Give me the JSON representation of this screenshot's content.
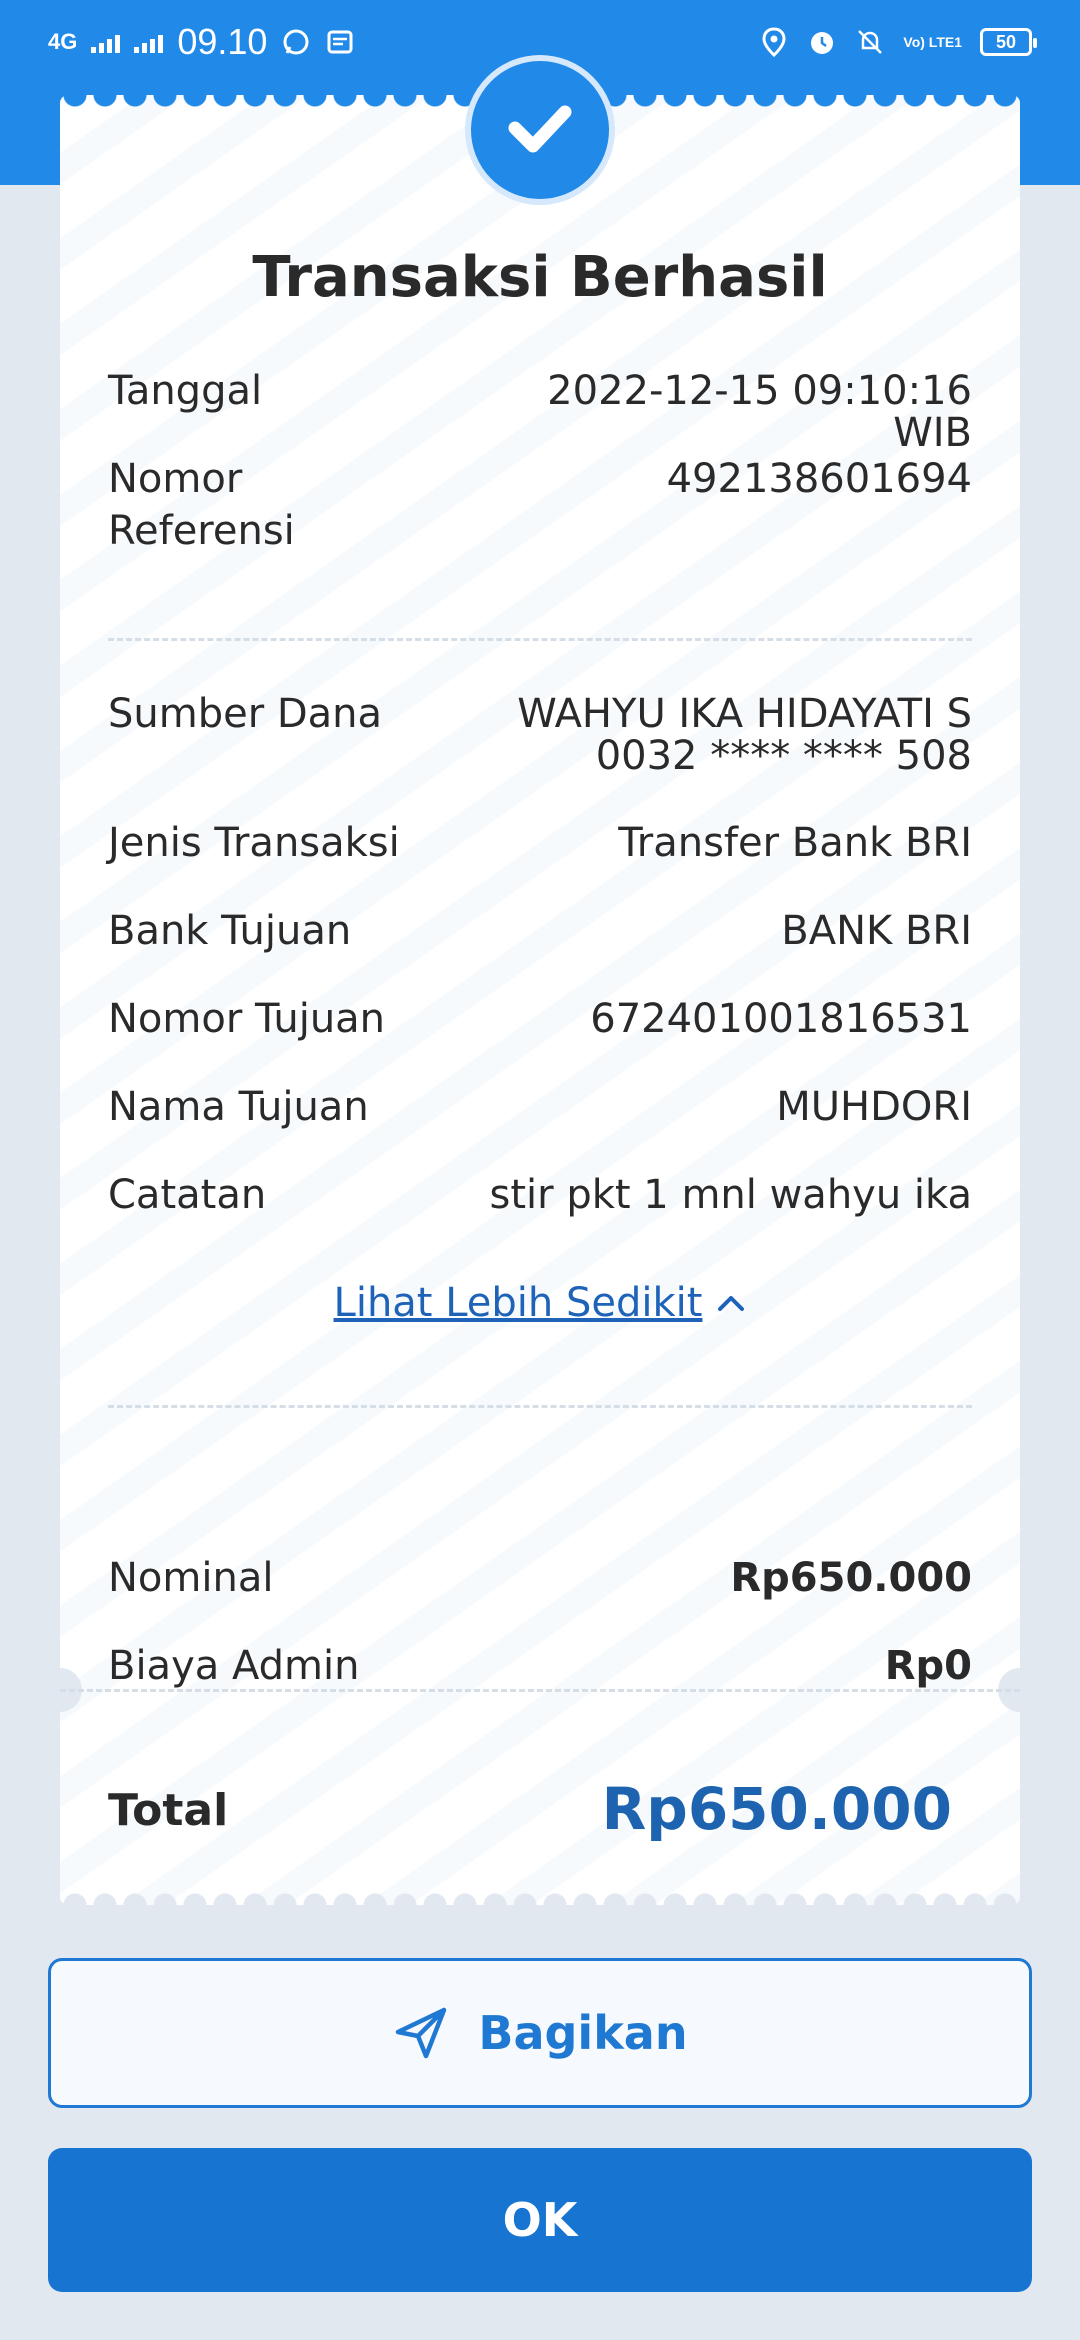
{
  "status_bar": {
    "network": "4G",
    "time": "09.10",
    "battery": "50",
    "volte": "Vo) LTE1"
  },
  "receipt": {
    "title": "Transaksi Berhasil",
    "tanggal": {
      "label": "Tanggal",
      "value": "2022-12-15 09:10:16 WIB"
    },
    "referensi": {
      "label_line1": "Nomor",
      "label_line2": "Referensi",
      "value": "492138601694"
    },
    "sumber_dana": {
      "label": "Sumber Dana",
      "value_line1": "WAHYU IKA HIDAYATI S",
      "value_line2": "0032 **** **** 508"
    },
    "jenis_transaksi": {
      "label": "Jenis Transaksi",
      "value": "Transfer Bank BRI"
    },
    "bank_tujuan": {
      "label": "Bank Tujuan",
      "value": "BANK BRI"
    },
    "nomor_tujuan": {
      "label": "Nomor Tujuan",
      "value": "672401001816531"
    },
    "nama_tujuan": {
      "label": "Nama Tujuan",
      "value": "MUHDORI"
    },
    "catatan": {
      "label": "Catatan",
      "value": "stir pkt 1 mnl wahyu ika"
    },
    "toggle_link": "Lihat Lebih Sedikit",
    "nominal": {
      "label": "Nominal",
      "value": "Rp650.000"
    },
    "biaya_admin": {
      "label": "Biaya Admin",
      "value": "Rp0"
    },
    "total": {
      "label": "Total",
      "value": "Rp650.000"
    }
  },
  "actions": {
    "share_label": "Bagikan",
    "ok_label": "OK"
  },
  "colors": {
    "brand_blue": "#2189e8",
    "button_blue": "#1774d1",
    "total_blue": "#1d63b0",
    "background": "#e1e8f0"
  },
  "icons": [
    "signal-icon",
    "whatsapp-icon",
    "message-icon",
    "location-icon",
    "alarm-icon",
    "mute-icon",
    "battery-icon",
    "check-icon",
    "chevron-up-icon",
    "send-icon"
  ]
}
